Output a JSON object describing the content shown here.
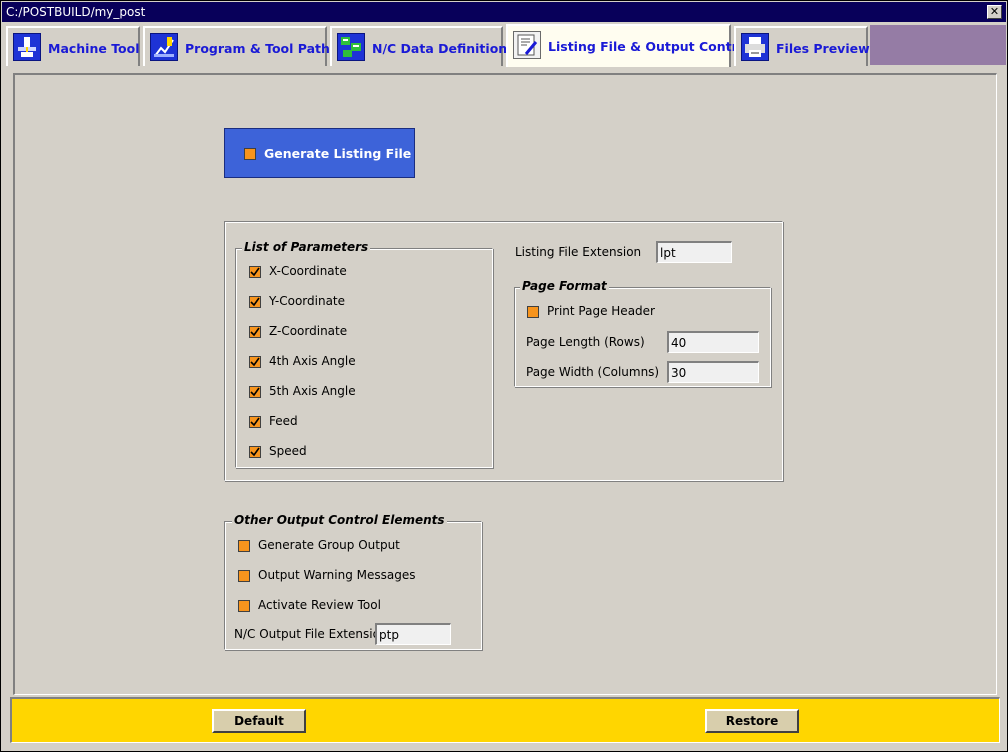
{
  "window": {
    "title": "C:/POSTBUILD/my_post",
    "close_glyph": "✕"
  },
  "tabs": [
    {
      "label": "Machine Tool",
      "icon": "machine-tool-icon"
    },
    {
      "label": "Program & Tool Path",
      "icon": "tool-path-icon"
    },
    {
      "label": "N/C Data Definitions",
      "icon": "nc-data-icon"
    },
    {
      "label": "Listing File & Output Control",
      "icon": "listing-file-icon",
      "active": true
    },
    {
      "label": "Files Preview",
      "icon": "printer-icon"
    }
  ],
  "generate_listing": {
    "label": "Generate Listing File",
    "checked": false
  },
  "parameters": {
    "title": "List of Parameters",
    "items": [
      {
        "label": "X-Coordinate",
        "checked": true
      },
      {
        "label": "Y-Coordinate",
        "checked": true
      },
      {
        "label": "Z-Coordinate",
        "checked": true
      },
      {
        "label": "4th Axis Angle",
        "checked": true
      },
      {
        "label": "5th Axis Angle",
        "checked": true
      },
      {
        "label": "Feed",
        "checked": true
      },
      {
        "label": "Speed",
        "checked": true
      }
    ]
  },
  "listing_extension": {
    "label": "Listing File Extension",
    "value": "lpt"
  },
  "page_format": {
    "title": "Page Format",
    "print_header": {
      "label": "Print Page Header",
      "checked": false
    },
    "page_length": {
      "label": "Page Length (Rows)",
      "value": "40"
    },
    "page_width": {
      "label": "Page Width (Columns)",
      "value": "30"
    }
  },
  "other_output": {
    "title": "Other Output Control Elements",
    "items": [
      {
        "label": "Generate Group Output",
        "checked": false
      },
      {
        "label": "Output Warning Messages",
        "checked": false
      },
      {
        "label": "Activate Review Tool",
        "checked": false
      }
    ],
    "nc_extension": {
      "label": "N/C Output File Extension",
      "value": "ptp"
    }
  },
  "buttons": {
    "default": "Default",
    "restore": "Restore"
  },
  "colors": {
    "title_bar": "#08005a",
    "tab_text": "#1a1ad6",
    "generate_button": "#3d63d9",
    "checkbox": "#f7941d",
    "bottom_bar": "#ffd600"
  }
}
